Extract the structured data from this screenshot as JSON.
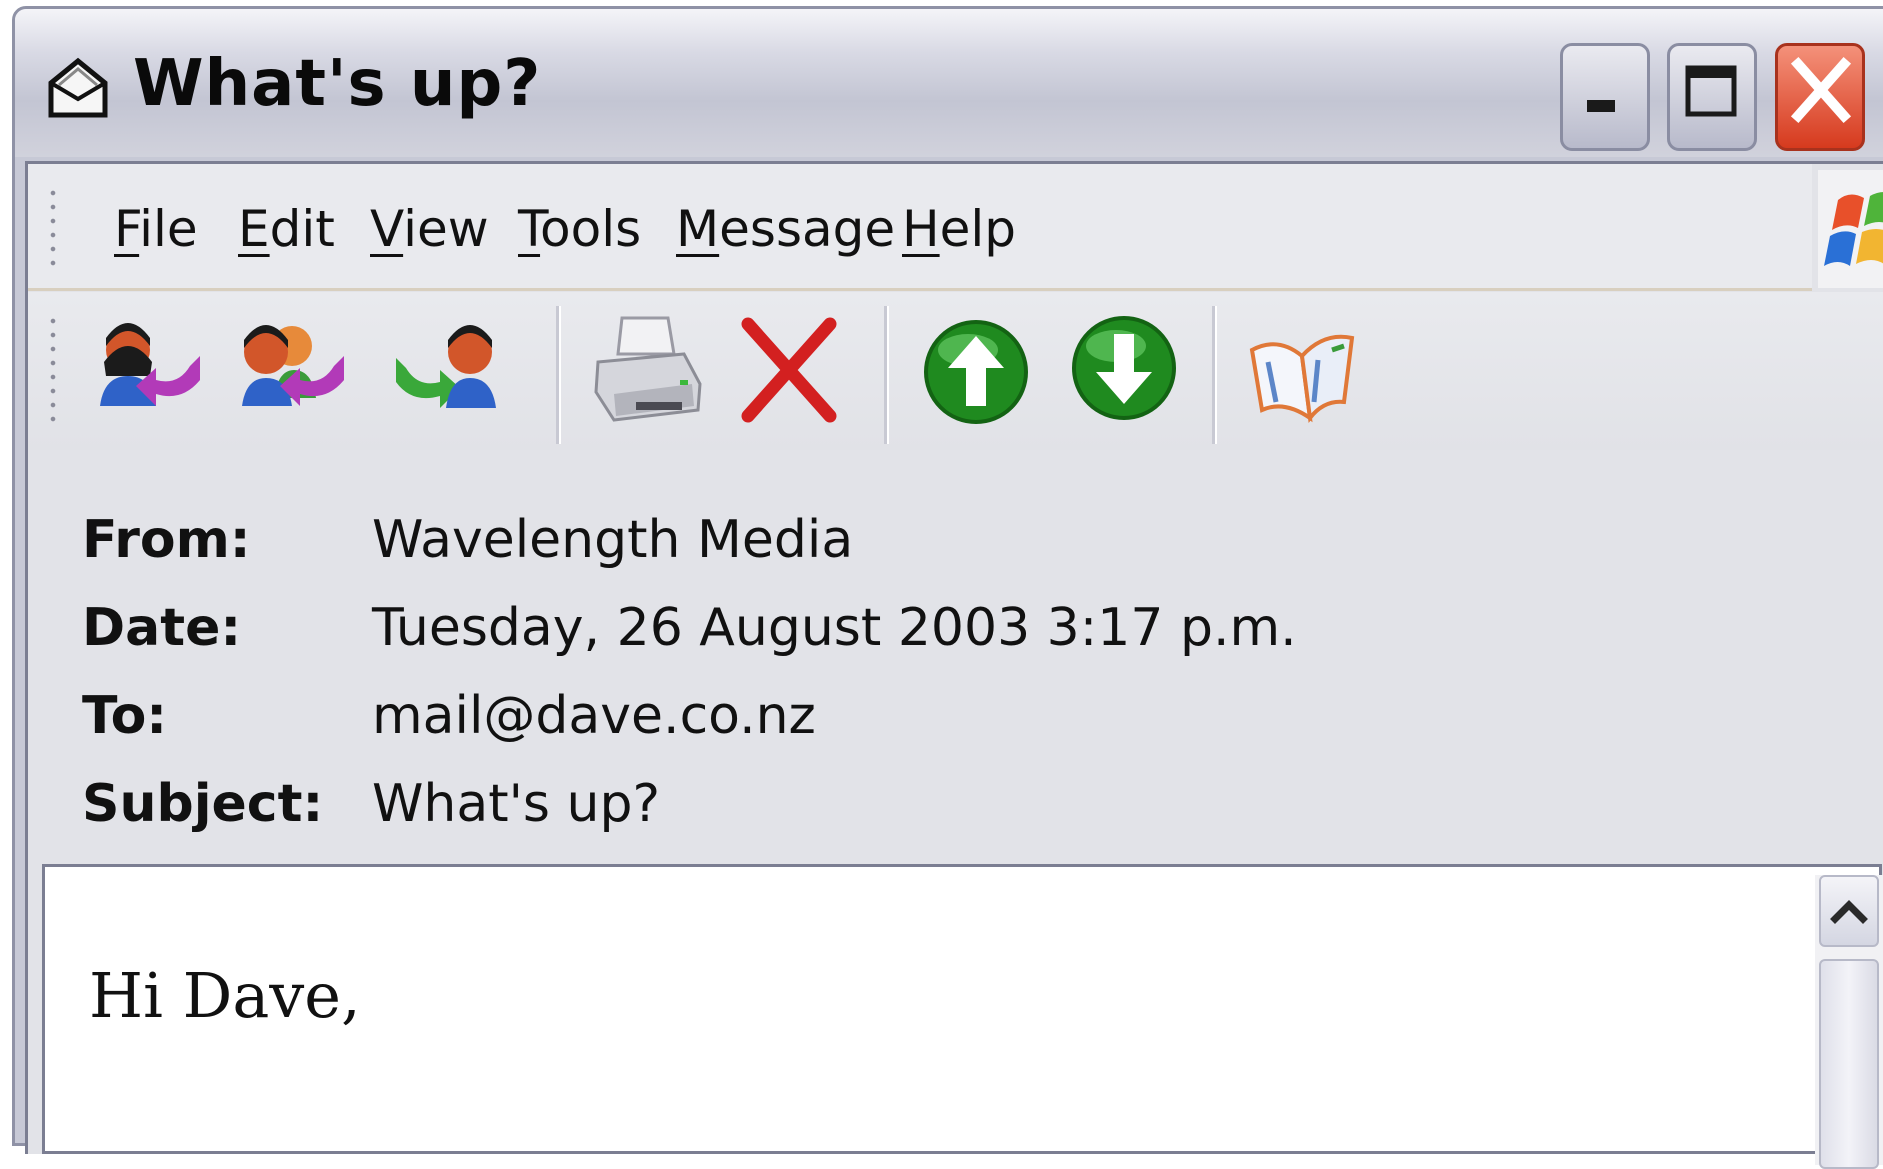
{
  "window": {
    "title": "What's up?",
    "controls": {
      "minimize": "minimize",
      "maximize": "maximize",
      "close": "close"
    }
  },
  "menubar": {
    "items": [
      {
        "label": "File",
        "mnemonic": "F"
      },
      {
        "label": "Edit",
        "mnemonic": "E"
      },
      {
        "label": "View",
        "mnemonic": "V"
      },
      {
        "label": "Tools",
        "mnemonic": "T"
      },
      {
        "label": "Message",
        "mnemonic": "M"
      },
      {
        "label": "Help",
        "mnemonic": "H"
      }
    ]
  },
  "toolbar": {
    "buttons": [
      {
        "name": "reply",
        "icon": "reply-icon"
      },
      {
        "name": "reply-all",
        "icon": "reply-all-icon"
      },
      {
        "name": "forward",
        "icon": "forward-icon"
      },
      {
        "name": "print",
        "icon": "printer-icon"
      },
      {
        "name": "delete",
        "icon": "delete-x-icon"
      },
      {
        "name": "previous",
        "icon": "up-arrow-icon"
      },
      {
        "name": "next",
        "icon": "down-arrow-icon"
      },
      {
        "name": "addresses",
        "icon": "address-book-icon"
      }
    ]
  },
  "headers": {
    "from": {
      "label": "From:",
      "value": "Wavelength Media"
    },
    "date": {
      "label": "Date:",
      "value": "Tuesday, 26 August 2003 3:17 p.m."
    },
    "to": {
      "label": "To:",
      "value": "mail@dave.co.nz"
    },
    "subject": {
      "label": "Subject:",
      "value": "What's up?"
    }
  },
  "body": {
    "greeting": "Hi Dave,"
  },
  "colors": {
    "close_red": "#d63a1e",
    "arrow_green": "#2ea02e",
    "delete_red": "#d32020",
    "window_frame": "#c7c9d6"
  }
}
